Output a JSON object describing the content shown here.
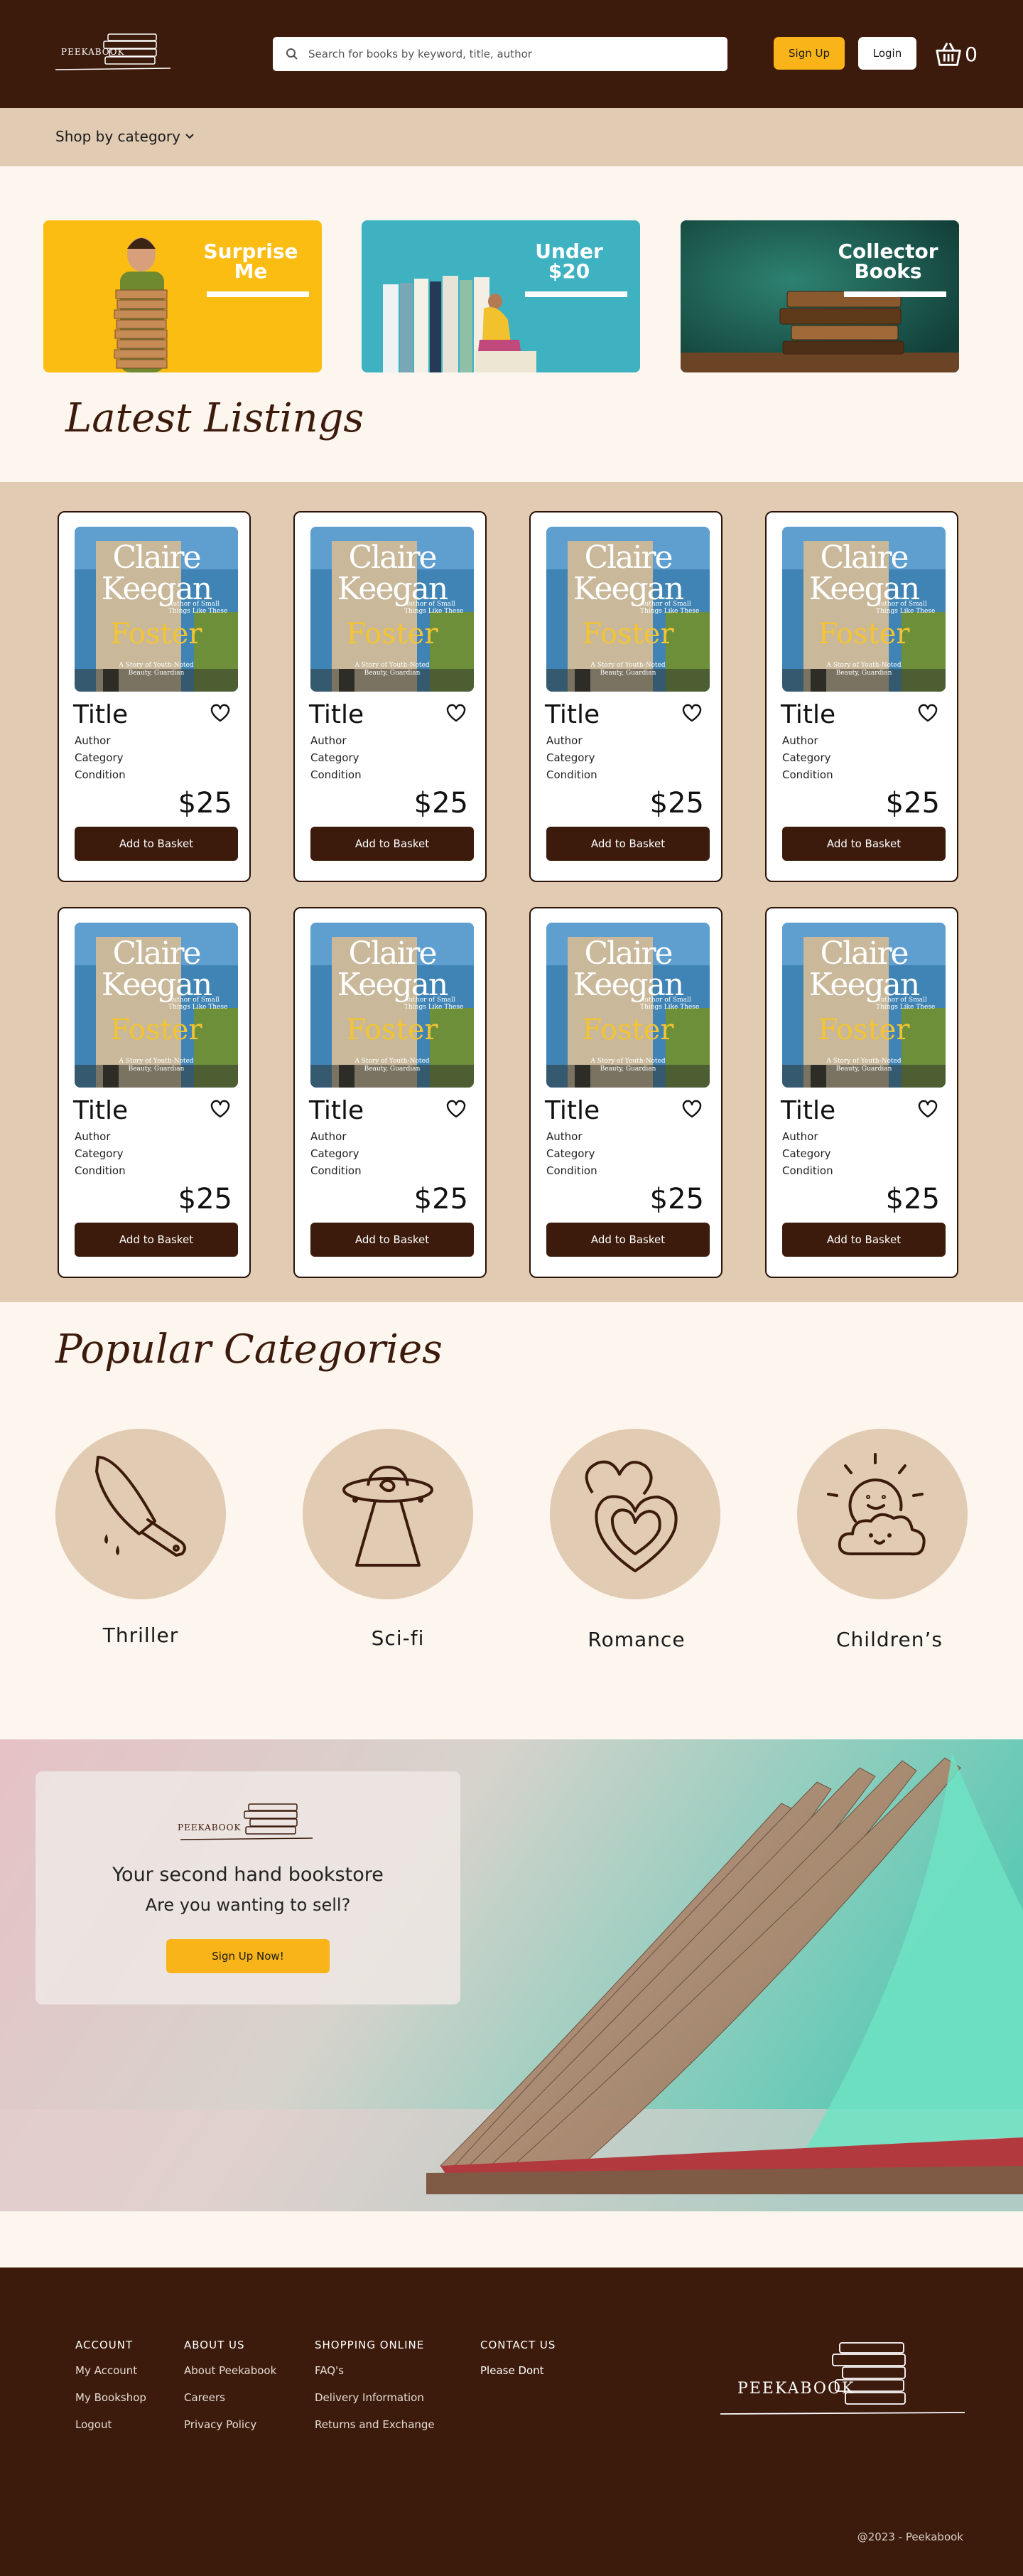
{
  "header": {
    "logo_text": "PEEKABOOK",
    "search_placeholder": "Search for books by keyword, title, author",
    "signup_label": "Sign Up",
    "login_label": "Login",
    "basket_count": "0"
  },
  "category_bar": {
    "shop_label": "Shop by category"
  },
  "promos": [
    {
      "label": "Surprise Me"
    },
    {
      "label": "Under $20"
    },
    {
      "label": "Collector Books"
    }
  ],
  "latest": {
    "heading": "Latest Listings",
    "cards": [
      {
        "title": "Title",
        "author": "Author",
        "category": "Category",
        "condition": "Condition",
        "price": "$25",
        "button": "Add to Basket",
        "cover": {
          "author": "Claire Keegan",
          "title": "Foster",
          "tag": "Author of Small Things Like These",
          "sub": "A Story of Youth-Noted Beauty, Guardian"
        }
      },
      {
        "title": "Title",
        "author": "Author",
        "category": "Category",
        "condition": "Condition",
        "price": "$25",
        "button": "Add to Basket",
        "cover": {
          "author": "Claire Keegan",
          "title": "Foster",
          "tag": "Author of Small Things Like These",
          "sub": "A Story of Youth-Noted Beauty, Guardian"
        }
      },
      {
        "title": "Title",
        "author": "Author",
        "category": "Category",
        "condition": "Condition",
        "price": "$25",
        "button": "Add to Basket",
        "cover": {
          "author": "Claire Keegan",
          "title": "Foster",
          "tag": "Author of Small Things Like These",
          "sub": "A Story of Youth-Noted Beauty, Guardian"
        }
      },
      {
        "title": "Title",
        "author": "Author",
        "category": "Category",
        "condition": "Condition",
        "price": "$25",
        "button": "Add to Basket",
        "cover": {
          "author": "Claire Keegan",
          "title": "Foster",
          "tag": "Author of Small Things Like These",
          "sub": "A Story of Youth-Noted Beauty, Guardian"
        }
      },
      {
        "title": "Title",
        "author": "Author",
        "category": "Category",
        "condition": "Condition",
        "price": "$25",
        "button": "Add to Basket",
        "cover": {
          "author": "Claire Keegan",
          "title": "Foster",
          "tag": "Author of Small Things Like These",
          "sub": "A Story of Youth-Noted Beauty, Guardian"
        }
      },
      {
        "title": "Title",
        "author": "Author",
        "category": "Category",
        "condition": "Condition",
        "price": "$25",
        "button": "Add to Basket",
        "cover": {
          "author": "Claire Keegan",
          "title": "Foster",
          "tag": "Author of Small Things Like These",
          "sub": "A Story of Youth-Noted Beauty, Guardian"
        }
      },
      {
        "title": "Title",
        "author": "Author",
        "category": "Category",
        "condition": "Condition",
        "price": "$25",
        "button": "Add to Basket",
        "cover": {
          "author": "Claire Keegan",
          "title": "Foster",
          "tag": "Author of Small Things Like These",
          "sub": "A Story of Youth-Noted Beauty, Guardian"
        }
      },
      {
        "title": "Title",
        "author": "Author",
        "category": "Category",
        "condition": "Condition",
        "price": "$25",
        "button": "Add to Basket",
        "cover": {
          "author": "Claire Keegan",
          "title": "Foster",
          "tag": "Author of Small Things Like These",
          "sub": "A Story of Youth-Noted Beauty, Guardian"
        }
      }
    ]
  },
  "popular": {
    "heading": "Popular Categories",
    "categories": [
      {
        "label": "Thriller",
        "icon": "knife-icon"
      },
      {
        "label": "Sci-fi",
        "icon": "ufo-icon"
      },
      {
        "label": "Romance",
        "icon": "hearts-icon"
      },
      {
        "label": "Children’s",
        "icon": "sun-cloud-icon"
      }
    ]
  },
  "sell_banner": {
    "logo_text": "PEEKABOOK",
    "line1": "Your second hand bookstore",
    "line2": "Are you wanting to sell?",
    "button": "Sign Up Now!"
  },
  "footer": {
    "columns": [
      {
        "heading": "ACCOUNT",
        "items": [
          "My Account",
          "My Bookshop",
          "Logout"
        ]
      },
      {
        "heading": "ABOUT US",
        "items": [
          "About Peekabook",
          "Careers",
          "Privacy Policy"
        ]
      },
      {
        "heading": "SHOPPING ONLINE",
        "items": [
          "FAQ's",
          "Delivery Information",
          "Returns and Exchange"
        ]
      },
      {
        "heading": "CONTACT US",
        "items": [
          "Please Dont"
        ]
      }
    ],
    "logo_text": "PEEKABOOK",
    "copyright": "@2023 - Peekabook"
  },
  "colors": {
    "brand_dark": "#3c1b0c",
    "accent": "#f8b418",
    "tan": "#e1cbb2",
    "cream": "#fdf6ef"
  }
}
